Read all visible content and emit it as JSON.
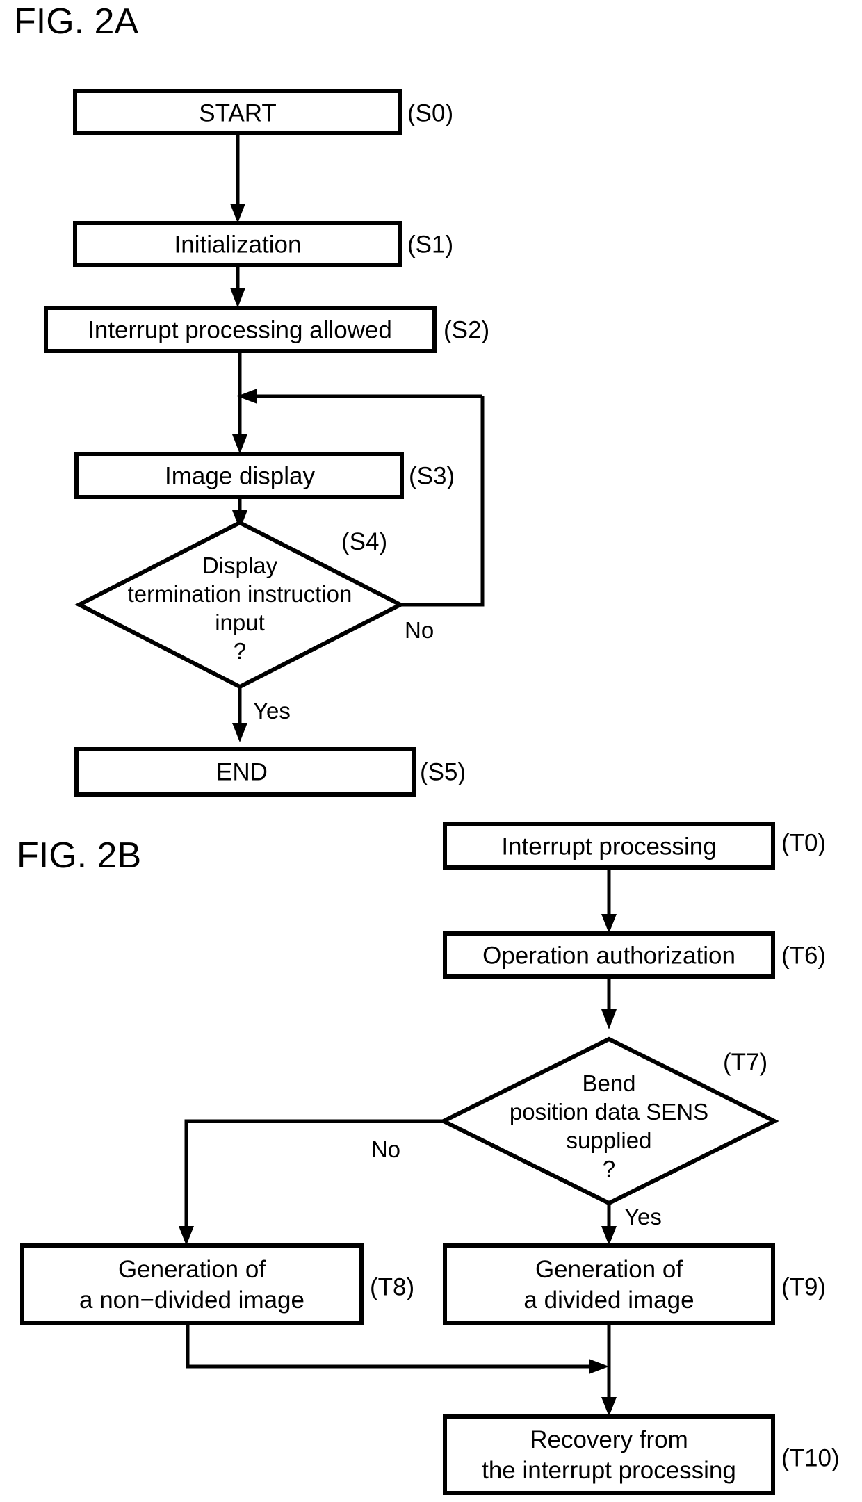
{
  "figures": [
    {
      "id": "fig-2a",
      "title": "FIG. 2A",
      "nodes": [
        {
          "id": "s0",
          "type": "process",
          "label": "START",
          "tag": "(S0)"
        },
        {
          "id": "s1",
          "type": "process",
          "label": "Initialization",
          "tag": "(S1)"
        },
        {
          "id": "s2",
          "type": "process",
          "label": "Interrupt processing allowed",
          "tag": "(S2)"
        },
        {
          "id": "s3",
          "type": "process",
          "label": "Image display",
          "tag": "(S3)"
        },
        {
          "id": "s4",
          "type": "decision",
          "label_line1": "Display",
          "label_line2": "termination instruction",
          "label_line3": "input",
          "label_line4": "?",
          "tag": "(S4)",
          "branch_no": "No",
          "branch_yes": "Yes"
        },
        {
          "id": "s5",
          "type": "process",
          "label": "END",
          "tag": "(S5)"
        }
      ]
    },
    {
      "id": "fig-2b",
      "title": "FIG. 2B",
      "nodes": [
        {
          "id": "t0",
          "type": "process",
          "label": "Interrupt processing",
          "tag": "(T0)"
        },
        {
          "id": "t6",
          "type": "process",
          "label": "Operation authorization",
          "tag": "(T6)"
        },
        {
          "id": "t7",
          "type": "decision",
          "label_line1": "Bend",
          "label_line2": "position data SENS",
          "label_line3": "supplied",
          "label_line4": "?",
          "tag": "(T7)",
          "branch_no": "No",
          "branch_yes": "Yes"
        },
        {
          "id": "t8",
          "type": "process",
          "label_line1": "Generation of",
          "label_line2": "a non−divided image",
          "tag": "(T8)"
        },
        {
          "id": "t9",
          "type": "process",
          "label_line1": "Generation of",
          "label_line2": "a divided image",
          "tag": "(T9)"
        },
        {
          "id": "t10",
          "type": "process",
          "label_line1": "Recovery from",
          "label_line2": "the interrupt processing",
          "tag": "(T10)"
        }
      ]
    }
  ],
  "colors": {
    "stroke": "#000000",
    "fill": "#ffffff",
    "background": "#ffffff"
  }
}
